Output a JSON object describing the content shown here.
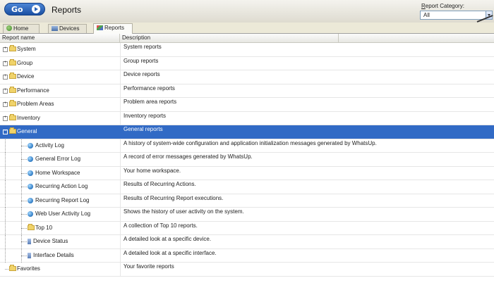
{
  "header": {
    "go_label": "Go",
    "title": "Reports",
    "category_label_prefix": "R",
    "category_label_rest": "eport Category:",
    "category_value": "All"
  },
  "tabs": [
    {
      "label": "Home",
      "icon": "home-icon"
    },
    {
      "label": "Devices",
      "icon": "devices-icon"
    },
    {
      "label": "Reports",
      "icon": "reports-icon",
      "active": true
    }
  ],
  "columns": {
    "name": "Report name",
    "description": "Description"
  },
  "rows": [
    {
      "name": "System",
      "description": "System reports",
      "kind": "folder",
      "level": 0
    },
    {
      "name": "Group",
      "description": "Group reports",
      "kind": "folder",
      "level": 0
    },
    {
      "name": "Device",
      "description": "Device reports",
      "kind": "folder",
      "level": 0
    },
    {
      "name": "Performance",
      "description": "Performance reports",
      "kind": "folder",
      "level": 0
    },
    {
      "name": "Problem Areas",
      "description": "Problem area reports",
      "kind": "folder",
      "level": 0
    },
    {
      "name": "Inventory",
      "description": "Inventory reports",
      "kind": "folder",
      "level": 0
    },
    {
      "name": "General",
      "description": "General reports",
      "kind": "folder",
      "level": 0,
      "selected": true
    },
    {
      "name": "Activity Log",
      "description": "A history of system-wide configuration and application initialization messages generated by WhatsUp.",
      "kind": "report",
      "level": 1
    },
    {
      "name": "General Error Log",
      "description": "A record of error messages generated by WhatsUp.",
      "kind": "report",
      "level": 1
    },
    {
      "name": "Home Workspace",
      "description": "Your home workspace.",
      "kind": "report",
      "level": 1
    },
    {
      "name": "Recurring Action Log",
      "description": "Results of Recurring Actions.",
      "kind": "report",
      "level": 1
    },
    {
      "name": "Recurring Report Log",
      "description": "Results of Recurring Report executions.",
      "kind": "report",
      "level": 1
    },
    {
      "name": "Web User Activity Log",
      "description": "Shows the history of user activity on the system.",
      "kind": "report",
      "level": 1
    },
    {
      "name": "Top 10",
      "description": "A collection of Top 10 reports.",
      "kind": "folder-leaf",
      "level": 1
    },
    {
      "name": "Device Status",
      "description": "A detailed look at a specific device.",
      "kind": "device",
      "level": 1
    },
    {
      "name": "Interface Details",
      "description": "A detailed look at a specific interface.",
      "kind": "device",
      "level": 1
    },
    {
      "name": "Favorites",
      "description": "Your favorite reports",
      "kind": "folder-leaf",
      "level": 0
    }
  ]
}
